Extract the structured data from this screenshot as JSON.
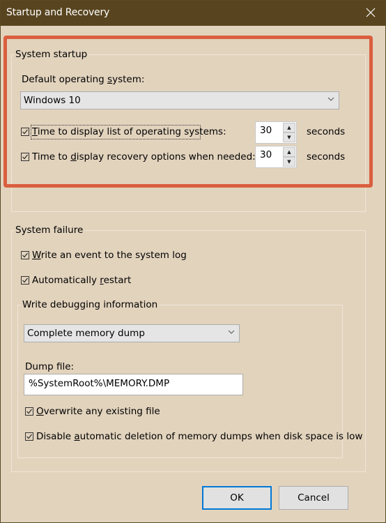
{
  "window": {
    "title": "Startup and Recovery",
    "close_icon": "close-icon"
  },
  "system_startup": {
    "group_title": "System startup",
    "default_os_label_pre": "Default operating ",
    "default_os_label_u": "s",
    "default_os_label_post": "ystem:",
    "default_os_value": "Windows 10",
    "time_list": {
      "checked": true,
      "label_u": "T",
      "label_post": "ime to display list of operating systems:",
      "value": "30",
      "unit": "seconds"
    },
    "time_recovery": {
      "checked": true,
      "label_pre": "Time to ",
      "label_u": "d",
      "label_post": "isplay recovery options when needed:",
      "value": "30",
      "unit": "seconds"
    }
  },
  "system_failure": {
    "group_title": "System failure",
    "write_event": {
      "checked": true,
      "label_u": "W",
      "label_post": "rite an event to the system log"
    },
    "auto_restart": {
      "checked": true,
      "label_pre": "Automatically ",
      "label_u": "r",
      "label_post": "estart"
    },
    "debug": {
      "group_title": "Write debugging information",
      "dump_type": "Complete memory dump",
      "dump_file_label": "Dump file:",
      "dump_file_value": "%SystemRoot%\\MEMORY.DMP",
      "overwrite": {
        "checked": true,
        "label_u": "O",
        "label_post": "verwrite any existing file"
      },
      "disable_auto_delete": {
        "checked": true,
        "label_pre": "Disable ",
        "label_u": "a",
        "label_post": "utomatic deletion of memory dumps when disk space is low"
      }
    }
  },
  "buttons": {
    "ok": "OK",
    "cancel": "Cancel"
  },
  "annotation": {
    "highlight_color": "#d95f3f"
  }
}
